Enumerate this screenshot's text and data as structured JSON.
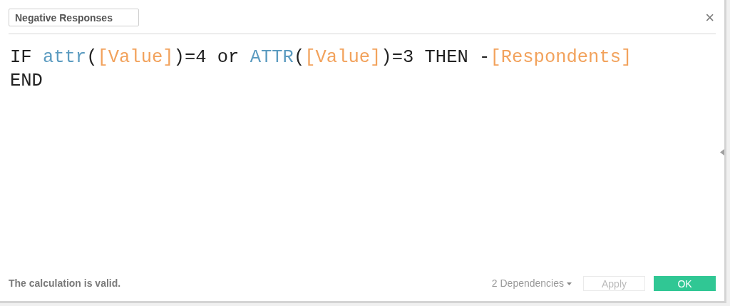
{
  "dialog": {
    "name_field": {
      "value": "Negative Responses"
    },
    "close": "×",
    "code_lines": [
      [
        {
          "kind": "keyword",
          "text": "IF "
        },
        {
          "kind": "function",
          "text": "attr"
        },
        {
          "kind": "plain",
          "text": "("
        },
        {
          "kind": "field",
          "text": "[Value]"
        },
        {
          "kind": "plain",
          "text": ")=4 or "
        },
        {
          "kind": "function",
          "text": "ATTR"
        },
        {
          "kind": "plain",
          "text": "("
        },
        {
          "kind": "field",
          "text": "[Value]"
        },
        {
          "kind": "plain",
          "text": ")=3 THEN -"
        },
        {
          "kind": "field",
          "text": "[Respondents]"
        }
      ],
      [
        {
          "kind": "keyword",
          "text": "END"
        }
      ]
    ],
    "status": "The calculation is valid.",
    "dependencies": "2 Dependencies",
    "buttons": [
      {
        "label": "Apply",
        "kind": "secondary",
        "disabled": true
      },
      {
        "label": "OK",
        "kind": "primary",
        "disabled": false
      }
    ]
  }
}
